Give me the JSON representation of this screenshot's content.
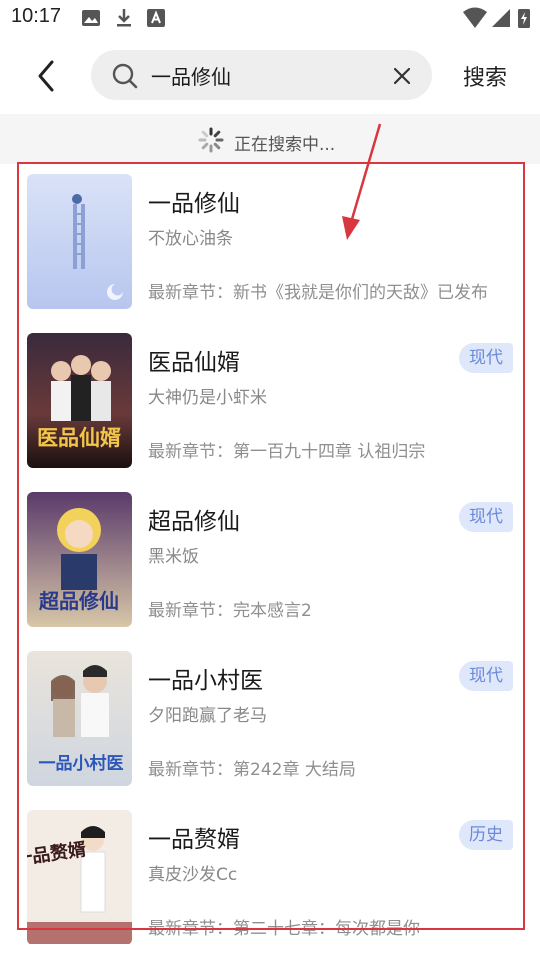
{
  "status_bar": {
    "time": "10:17"
  },
  "header": {
    "back_icon": "chevron-left-icon",
    "search_query": "一品修仙",
    "search_button": "搜索"
  },
  "banner": {
    "text": "正在搜索中..."
  },
  "results": [
    {
      "title": "一品修仙",
      "author": "不放心油条",
      "latest": "最新章节：新书《我就是你们的天敌》已发布",
      "tag": ""
    },
    {
      "title": "医品仙婿",
      "author": "大神仍是小虾米",
      "latest": "最新章节：第一百九十四章 认祖归宗",
      "tag": "现代",
      "cover_text": "医品仙婿"
    },
    {
      "title": "超品修仙",
      "author": "黑米饭",
      "latest": "最新章节：完本感言2",
      "tag": "现代",
      "cover_text": "超品修仙"
    },
    {
      "title": "一品小村医",
      "author": "夕阳跑赢了老马",
      "latest": "最新章节：第242章 大结局",
      "tag": "现代",
      "cover_text": "一品小村医"
    },
    {
      "title": "一品赘婿",
      "author": "真皮沙发Cc",
      "latest": "最新章节：第二十七章：每次都是你",
      "tag": "历史",
      "cover_text": "一品赘婿"
    }
  ],
  "colors": {
    "accent_tag_bg": "#dfe7fb",
    "accent_tag_text": "#6b89d9",
    "annotation": "#d9373f"
  }
}
